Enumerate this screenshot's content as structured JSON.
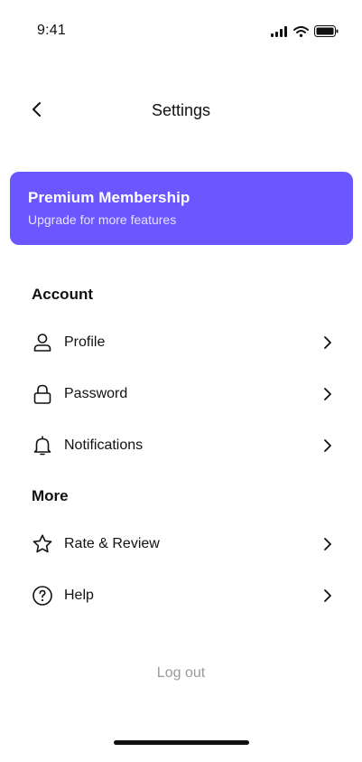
{
  "status_bar": {
    "time": "9:41",
    "icons": [
      "signal-icon",
      "wifi-icon",
      "battery-icon"
    ]
  },
  "header": {
    "title": "Settings",
    "back_icon": "chevron-left-icon"
  },
  "premium": {
    "title": "Premium Membership",
    "subtitle": "Upgrade for more features",
    "color": "#6b57ff"
  },
  "account": {
    "title": "Account",
    "items": [
      {
        "label": "Profile",
        "icon": "user-icon"
      },
      {
        "label": "Password",
        "icon": "lock-icon"
      },
      {
        "label": "Notifications",
        "icon": "bell-icon"
      }
    ]
  },
  "more": {
    "title": "More",
    "items": [
      {
        "label": "Rate & Review",
        "icon": "star-icon"
      },
      {
        "label": "Help",
        "icon": "help-icon"
      }
    ]
  },
  "logout_label": "Log out"
}
